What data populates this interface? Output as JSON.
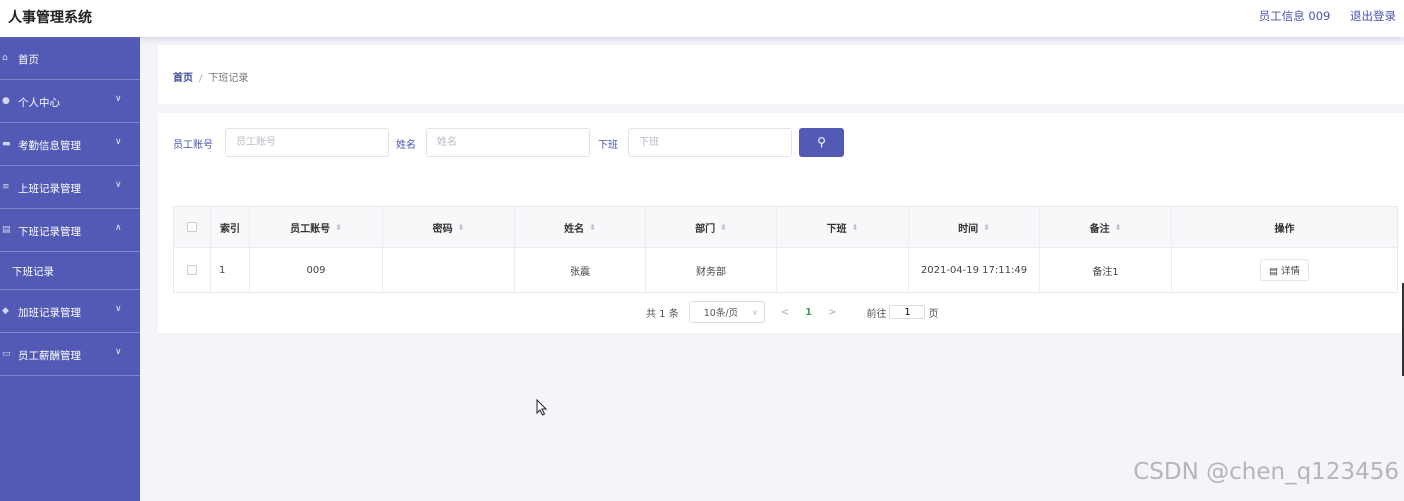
{
  "header": {
    "title": "人事管理系统",
    "user_info": "员工信息 009",
    "logout": "退出登录"
  },
  "sidebar": {
    "items": [
      {
        "icon": "home-icon",
        "label": "首页"
      },
      {
        "icon": "user-icon",
        "label": "个人中心"
      },
      {
        "icon": "calendar-icon",
        "label": "考勤信息管理"
      },
      {
        "icon": "list-icon",
        "label": "上班记录管理"
      },
      {
        "icon": "clipboard-icon",
        "label": "下班记录管理"
      },
      {
        "icon": "shield-icon",
        "label": "加班记录管理"
      },
      {
        "icon": "chat-icon",
        "label": "员工薪酬管理"
      }
    ],
    "sub_item": "下班记录"
  },
  "breadcrumb": {
    "home": "首页",
    "separator": "/",
    "current": "下班记录"
  },
  "search": {
    "field1_label": "员工账号",
    "field1_placeholder": "员工账号",
    "field2_label": "姓名",
    "field2_placeholder": "姓名",
    "field3_label": "下班",
    "field3_placeholder": "下班"
  },
  "table": {
    "columns": [
      "索引",
      "员工账号",
      "密码",
      "姓名",
      "部门",
      "下班",
      "时间",
      "备注",
      "操作"
    ],
    "rows": [
      {
        "index": "1",
        "account": "009",
        "password": "",
        "name": "张震",
        "dept": "财务部",
        "off": "",
        "time": "2021-04-19 17:11:49",
        "note": "备注1",
        "action": "详情"
      }
    ]
  },
  "pagination": {
    "total": "共 1 条",
    "page_size": "10条/页",
    "current_page": "1",
    "goto_label": "前往",
    "goto_value": "1",
    "goto_unit": "页"
  },
  "watermark": "CSDN @chen_q123456",
  "colors": {
    "accent": "#525ab5",
    "active_page": "#3aa15d"
  }
}
